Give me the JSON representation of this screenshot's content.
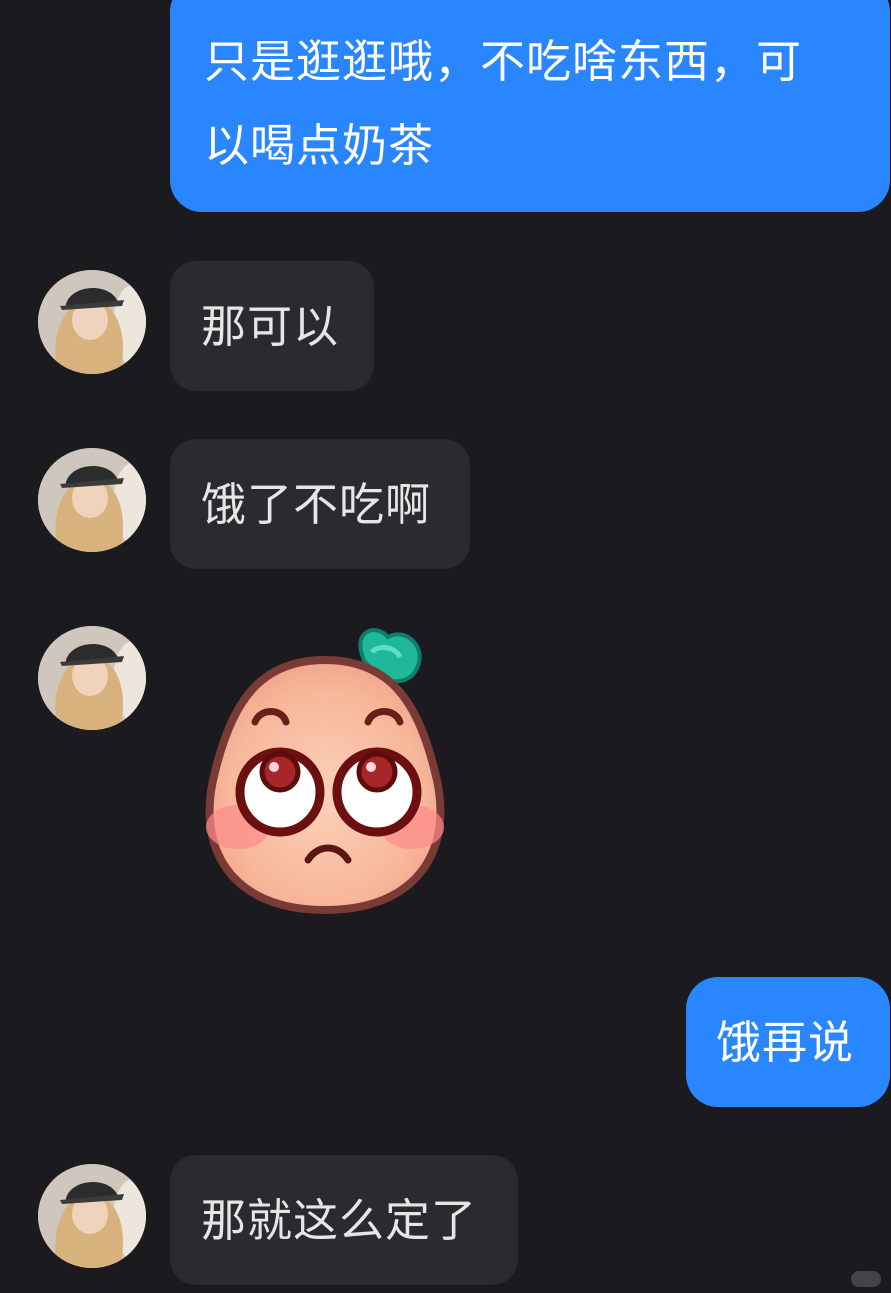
{
  "messages": [
    {
      "side": "out",
      "text_line1": "只是逛逛哦，不吃啥东西，可",
      "text_line2": "以喝点奶茶"
    },
    {
      "side": "in",
      "text": "那可以"
    },
    {
      "side": "in",
      "text": "饿了不吃啊"
    },
    {
      "side": "in",
      "type": "sticker",
      "sticker": "peach-rolling-eyes-sticker"
    },
    {
      "side": "out",
      "text": "饿再说"
    },
    {
      "side": "in",
      "text": "那就这么定了"
    }
  ],
  "colors": {
    "background": "#1b1b1f",
    "outgoing_bubble": "#2a86ff",
    "incoming_bubble": "#2a2a2f",
    "incoming_text": "#e6e6e6"
  }
}
